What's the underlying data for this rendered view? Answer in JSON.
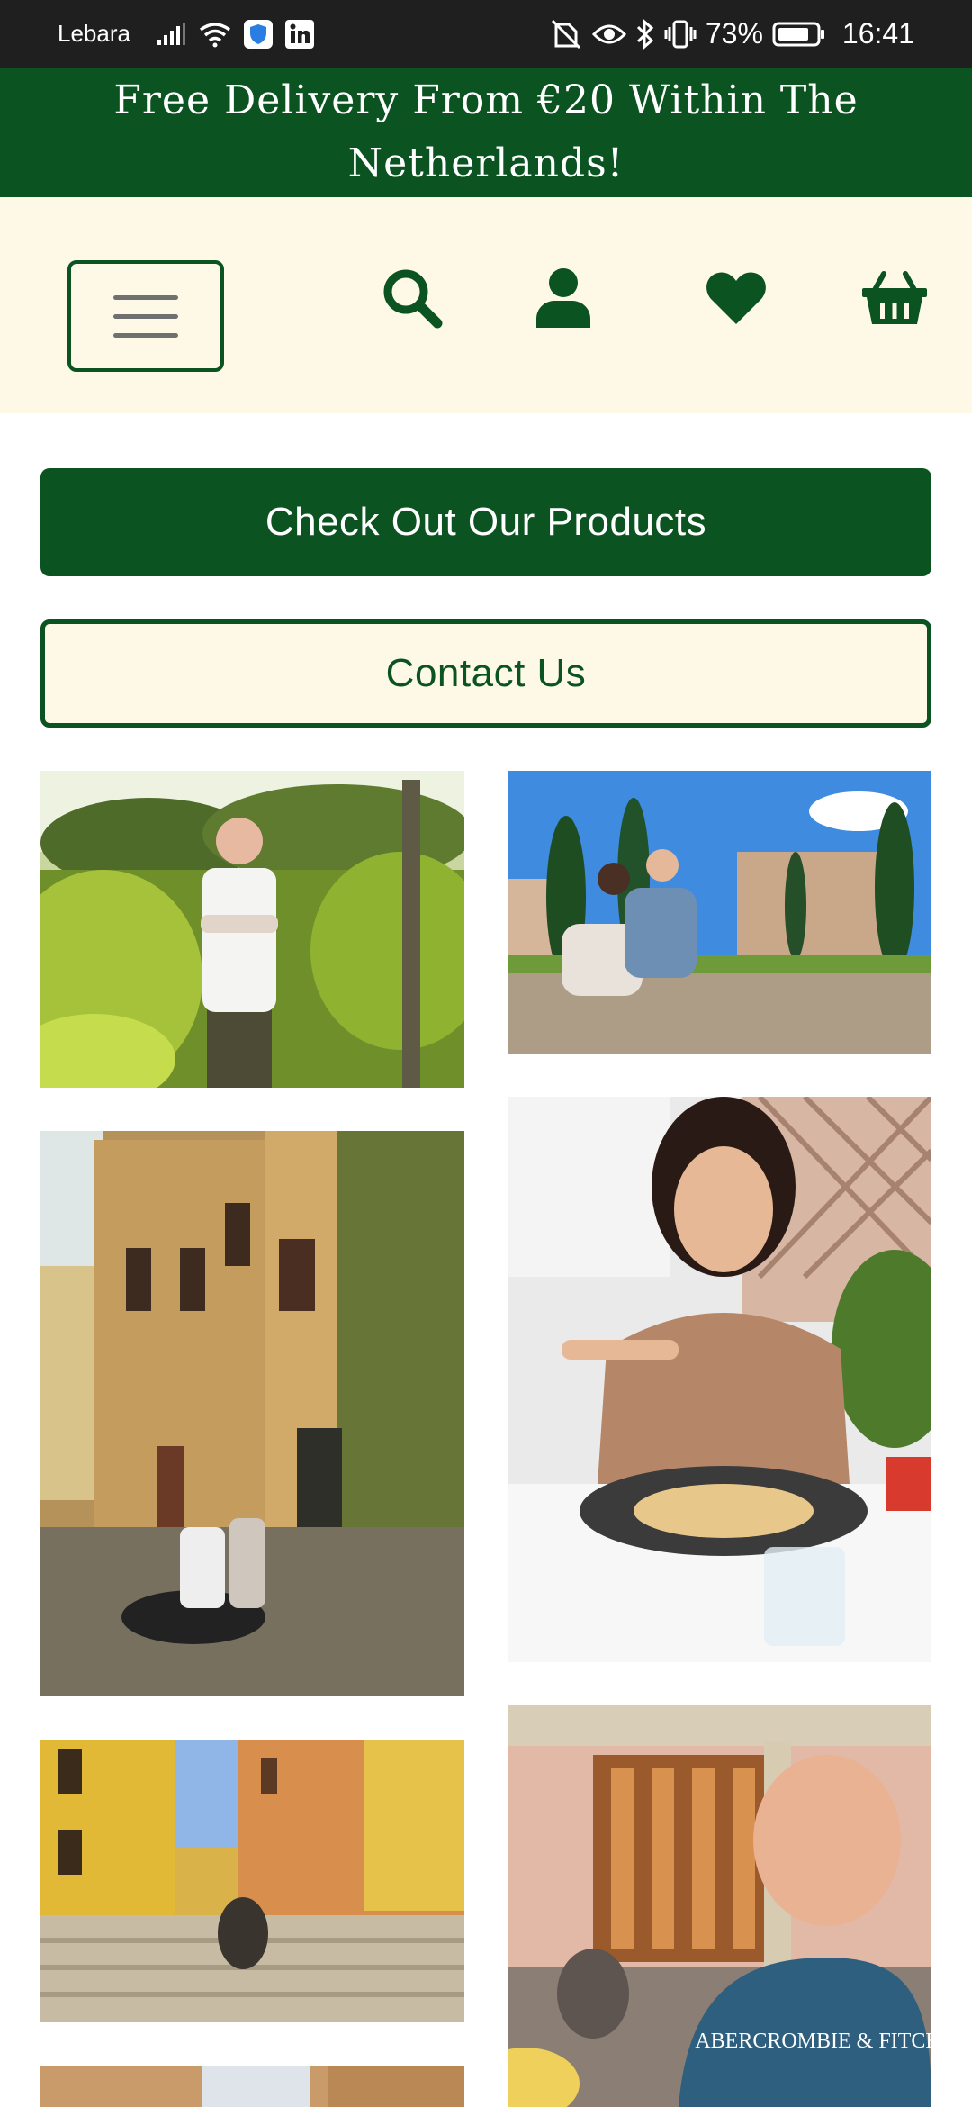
{
  "status_bar": {
    "carrier": "Lebara",
    "battery_percent": "73%",
    "time": "16:41"
  },
  "promo": {
    "text": "Free Delivery From €20 Within The Netherlands!"
  },
  "header": {
    "menu_icon": "hamburger-menu-icon",
    "icons": [
      "search-icon",
      "account-icon",
      "heart-icon",
      "basket-icon"
    ]
  },
  "buttons": {
    "products_label": "Check Out Our Products",
    "contact_label": "Contact Us"
  },
  "colors": {
    "brand_green": "#0b5320",
    "cream": "#fef9e6",
    "status_bar": "#1f1f1f"
  },
  "gallery": {
    "photos": [
      "vineyard-man-photo",
      "colosseum-couple-photo",
      "rome-street-scooter-photo",
      "woman-eating-pasta-photo",
      "couple-on-steps-photo",
      "man-selfie-restaurant-photo",
      "street-photo"
    ],
    "shirt_text": "ABERCROMBIE & FITCH"
  }
}
